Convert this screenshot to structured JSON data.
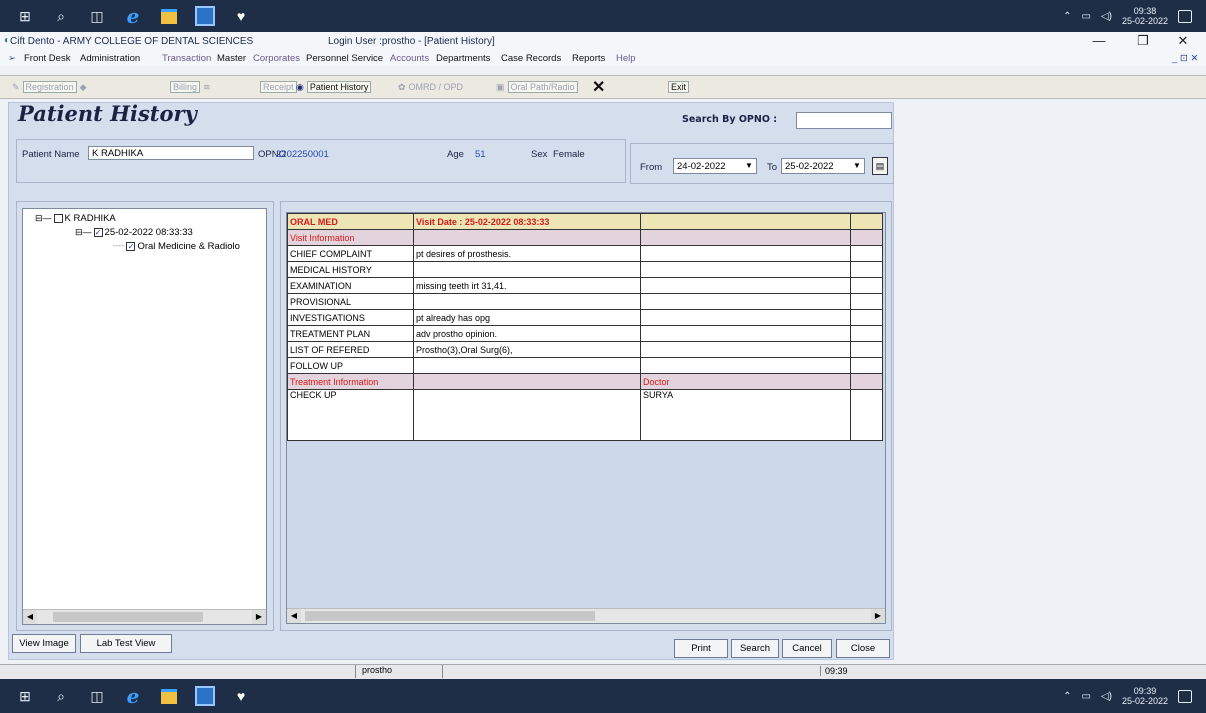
{
  "taskbar_top": {
    "clock_time": "09:38",
    "clock_date": "25-02-2022"
  },
  "window": {
    "app_title": "Cift Dento - ARMY COLLEGE OF DENTAL SCIENCES",
    "login_title": "Login User :prostho - [Patient History]",
    "menu": [
      "Front Desk",
      "Administration",
      "Transaction",
      "Master",
      "Corporates",
      "Personnel Service",
      "Accounts",
      "Departments",
      "Case Records",
      "Reports",
      "Help"
    ],
    "toolbar": {
      "registration": "Registration",
      "billing": "Billing",
      "receipt": "Receipt",
      "patient_history": "Patient History",
      "omrd": "OMRD / OPD",
      "oral_path": "Oral Path/Radio",
      "exit": "Exit"
    }
  },
  "page": {
    "heading": "Patient History",
    "search_label": "Search By OPNO :",
    "search_value": "",
    "patient_name_label": "Patient Name",
    "patient_name": "K RADHIKA",
    "opno_label": "OPNO",
    "opno": "2202250001",
    "age_label": "Age",
    "age": "51",
    "sex_label": "Sex",
    "sex": "Female",
    "from_label": "From",
    "from_date": "24-02-2022",
    "to_label": "To",
    "to_date": "25-02-2022"
  },
  "tree": {
    "root": "K RADHIKA",
    "visit": "25-02-2022 08:33:33",
    "dept": "Oral  Medicine & Radiolo"
  },
  "grid": {
    "header_left": "ORAL MED",
    "header_visit": "Visit Date : 25-02-2022 08:33:33",
    "visit_info": "Visit Information",
    "rows": [
      {
        "label": "CHIEF COMPLAINT",
        "value": "pt desires of prosthesis."
      },
      {
        "label": "MEDICAL HISTORY",
        "value": ""
      },
      {
        "label": "EXAMINATION",
        "value": "missing teeth irt 31,41."
      },
      {
        "label": "PROVISIONAL",
        "value": ""
      },
      {
        "label": "INVESTIGATIONS",
        "value": "pt already has opg"
      },
      {
        "label": "TREATMENT PLAN",
        "value": "adv prostho opinion."
      },
      {
        "label": "LIST OF REFERED",
        "value": "Prostho(3),Oral Surg(6),"
      },
      {
        "label": "FOLLOW UP",
        "value": ""
      }
    ],
    "treatment_info": "Treatment Information",
    "doctor_label": "Doctor",
    "treatment_row": {
      "label": "CHECK UP",
      "doctor": "SURYA"
    }
  },
  "buttons": {
    "view_image": "View Image",
    "lab_test": "Lab Test View",
    "print": "Print",
    "search": "Search",
    "cancel": "Cancel",
    "close": "Close"
  },
  "statusbar": {
    "user": "prostho",
    "time": "09:39"
  },
  "taskbar_bottom": {
    "clock_time": "09:39",
    "clock_date": "25-02-2022"
  }
}
